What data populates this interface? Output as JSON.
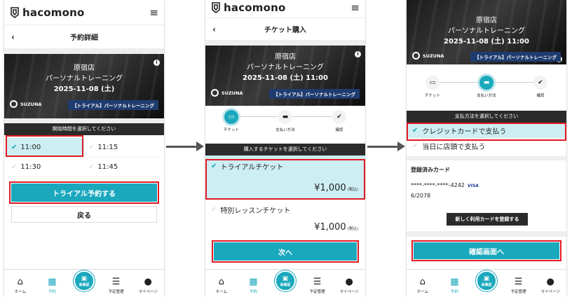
{
  "brand": "hacomono",
  "common": {
    "store": "原宿店",
    "program": "パーソナルトレーニング",
    "datetime": "2025-11-08 (土) 11:00",
    "date_only": "2025-11-08 (土)",
    "trainer": "SUZUNA",
    "tag": "【トライアル】パーソナルトレーニング",
    "info": "i"
  },
  "tabs": [
    {
      "label": "ホーム",
      "icon": "home-icon"
    },
    {
      "label": "予約",
      "icon": "calendar-icon"
    },
    {
      "label": "会員証",
      "icon": "qr-code-icon"
    },
    {
      "label": "予定管理",
      "icon": "list-icon"
    },
    {
      "label": "マイページ",
      "icon": "user-icon"
    }
  ],
  "screen1": {
    "title": "予約詳細",
    "prompt": "開始時間を選択してください",
    "slots": [
      {
        "time": "11:00",
        "selected": true
      },
      {
        "time": "11:15",
        "selected": false
      },
      {
        "time": "11:30",
        "selected": false
      },
      {
        "time": "11:45",
        "selected": false
      }
    ],
    "primary": "トライアル予約する",
    "back": "戻る"
  },
  "screen2": {
    "title": "チケット購入",
    "steps": [
      "チケット",
      "支払い方法",
      "確認"
    ],
    "prompt": "購入するチケットを選択してください",
    "tickets": [
      {
        "name": "トライアルチケット",
        "price": "¥1,000",
        "tax": "(税込)",
        "selected": true
      },
      {
        "name": "特別レッスンチケット",
        "price": "¥1,000",
        "tax": "(税込)",
        "selected": false
      }
    ],
    "next": "次へ"
  },
  "screen3": {
    "steps": [
      "チケット",
      "支払い方法",
      "確認"
    ],
    "prompt": "支払方法を選択してください",
    "methods": [
      {
        "label": "クレジットカードで支払う",
        "selected": true
      },
      {
        "label": "当日に店頭で支払う",
        "selected": false
      }
    ],
    "cards_title": "登録済みカード",
    "card_number": "****-****-****-4242",
    "card_brand": "VISA",
    "card_expiry": "6/2078",
    "add_card": "新しく利用カードを登録する",
    "confirm": "確認画面へ"
  },
  "colors": {
    "accent": "#1aa8bd",
    "highlight": "#e01b24",
    "selected_bg": "#cdeef2",
    "tag_bg": "#1f3c70"
  }
}
